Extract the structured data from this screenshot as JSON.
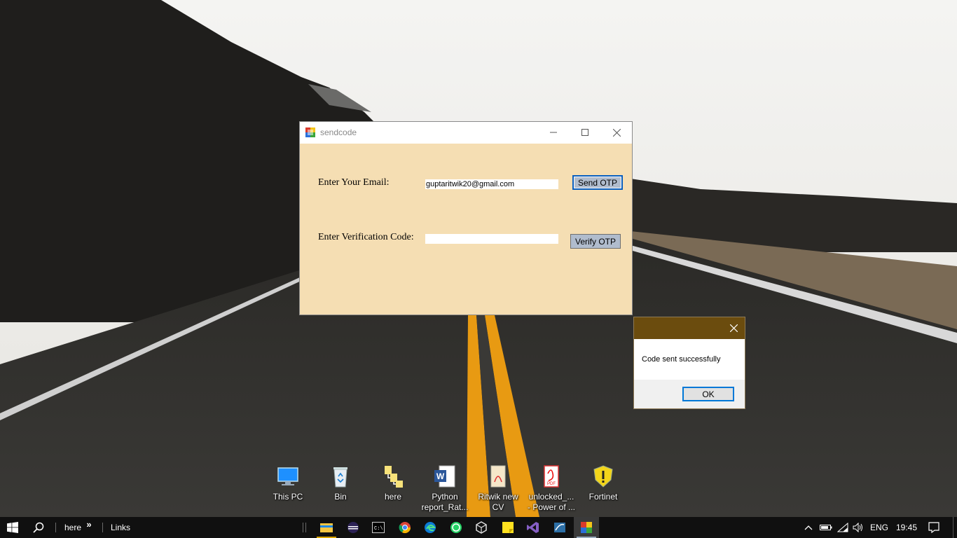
{
  "desktop": {
    "icons": [
      {
        "label": "This PC",
        "icon": "computer-icon"
      },
      {
        "label": "Bin",
        "icon": "recycle-bin-icon"
      },
      {
        "label": "here",
        "icon": "folder-shortcut-icon"
      },
      {
        "label": "Python\nreport_Rat...",
        "icon": "word-document-icon"
      },
      {
        "label": "Ritwik new\nCV",
        "icon": "pdf-document-icon"
      },
      {
        "label": "unlocked_...\n- Power of ...",
        "icon": "pdf-acrobat-icon"
      },
      {
        "label": "Fortinet",
        "icon": "fortinet-shield-icon"
      }
    ]
  },
  "window": {
    "title": "sendcode",
    "email_label": "Enter Your Email:",
    "email_value": "guptaritwik20@gmail.com",
    "send_button": "Send OTP",
    "code_label": "Enter Verification Code:",
    "code_value": "",
    "verify_button": "Verify OTP"
  },
  "message_box": {
    "text": "Code sent successfully",
    "ok_button": "OK"
  },
  "taskbar": {
    "search_toolbar": "here",
    "chevron": "»",
    "links_toolbar": "Links",
    "apps": [
      "file-explorer-icon",
      "eclipse-icon",
      "command-prompt-icon",
      "chrome-icon",
      "edge-icon",
      "whatsapp-icon",
      "virtualbox-icon",
      "sticky-notes-icon",
      "visual-studio-icon",
      "sql-server-icon",
      "sendcode-app-icon"
    ],
    "tray": {
      "language": "ENG",
      "time": "19:45"
    }
  },
  "colors": {
    "form_background": "#f5deb3",
    "button_background": "#b0bccd",
    "message_titlebar": "#6b4c0e",
    "taskbar": "#101010"
  }
}
